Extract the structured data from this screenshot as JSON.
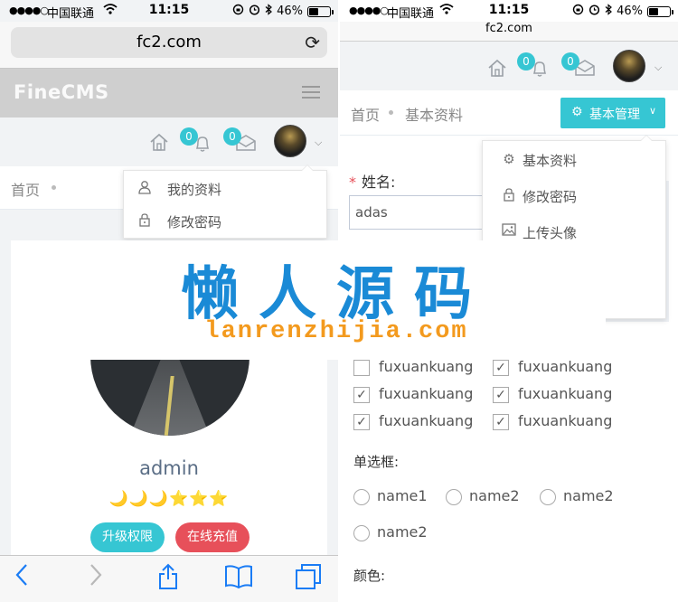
{
  "status_bar": {
    "signal": "●●●●○",
    "carrier": "中国联通",
    "time": "11:15",
    "battery": "46%"
  },
  "left": {
    "url": "fc2.com",
    "brand": "FineCMS",
    "badge_notices": "0",
    "badge_messages": "0",
    "breadcrumb_home": "首页",
    "user_menu": [
      {
        "icon": "user-icon",
        "label": "我的资料"
      },
      {
        "icon": "lock-icon",
        "label": "修改密码"
      }
    ],
    "username": "admin",
    "level_icons": "🌙🌙🌙⭐⭐⭐",
    "upgrade_button": "升级权限",
    "recharge_button": "在线充值"
  },
  "right": {
    "url": "fc2.com",
    "badge_notices": "0",
    "badge_messages": "0",
    "breadcrumb_home": "首页",
    "breadcrumb_page": "基本资料",
    "manage_button": "基本管理",
    "dropdown": [
      {
        "icon": "gear-icon",
        "label": "基本资料"
      },
      {
        "icon": "lock-icon",
        "label": "修改密码"
      },
      {
        "icon": "image-icon",
        "label": "上传头像"
      }
    ],
    "name_label": "姓名:",
    "name_value": "adas",
    "checkbox_label": "fuxuankuang",
    "checkboxes": [
      false,
      true,
      true,
      true,
      true,
      true
    ],
    "radio_section_label": "单选框:",
    "radios": [
      "name1",
      "name2",
      "name2",
      "name2"
    ],
    "color_label": "颜色:"
  },
  "watermark": {
    "cn": "懒人源码",
    "en": "lanrenzhijia.com"
  },
  "colors": {
    "accent": "#36c6d3",
    "danger": "#e7505a",
    "brand_bar": "#cfcfcf"
  }
}
